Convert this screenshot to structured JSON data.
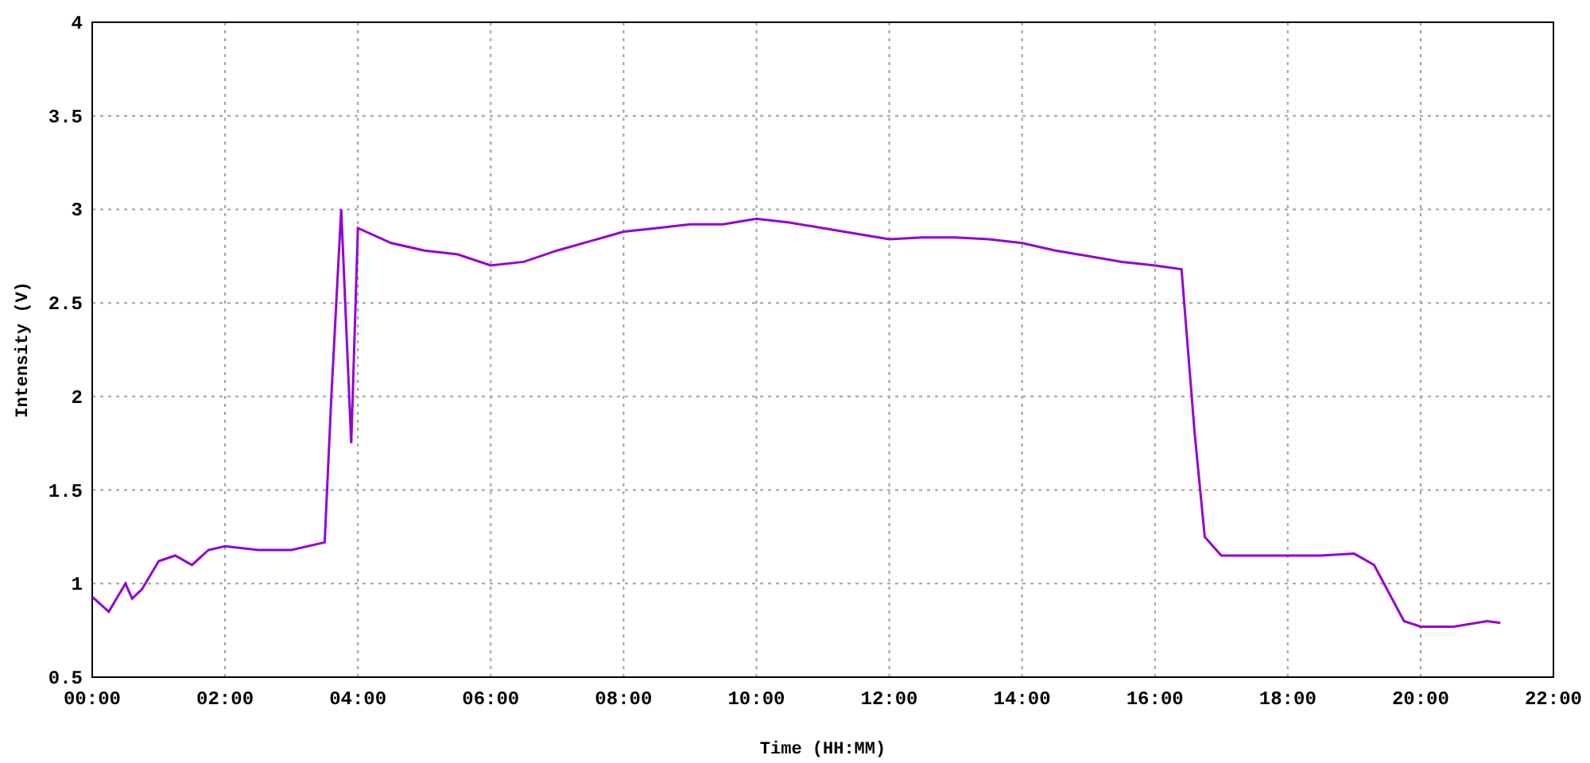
{
  "chart_data": {
    "type": "line",
    "grid": true,
    "xlabel": "Time (HH:MM)",
    "ylabel": "Intensity (V)",
    "x": [
      0,
      0.25,
      0.5,
      0.6,
      0.75,
      1,
      1.25,
      1.5,
      1.75,
      2,
      2.5,
      3,
      3.5,
      3.6,
      3.75,
      3.9,
      4,
      4.5,
      5,
      5.5,
      6,
      6.5,
      7,
      7.5,
      8,
      8.5,
      9,
      9.5,
      10,
      10.5,
      11,
      11.5,
      12,
      12.5,
      13,
      13.5,
      14,
      14.5,
      15,
      15.5,
      16,
      16.4,
      16.6,
      16.75,
      17,
      17.5,
      18,
      18.5,
      19,
      19.3,
      19.75,
      20,
      20.5,
      21,
      21.2
    ],
    "series": [
      {
        "color": "#9400d3",
        "values": [
          0.93,
          0.85,
          1.0,
          0.92,
          0.97,
          1.12,
          1.15,
          1.1,
          1.18,
          1.2,
          1.18,
          1.18,
          1.22,
          2.0,
          3.0,
          1.75,
          2.9,
          2.82,
          2.78,
          2.76,
          2.7,
          2.72,
          2.78,
          2.83,
          2.88,
          2.9,
          2.92,
          2.92,
          2.95,
          2.93,
          2.9,
          2.87,
          2.84,
          2.85,
          2.85,
          2.84,
          2.82,
          2.78,
          2.75,
          2.72,
          2.7,
          2.68,
          1.8,
          1.25,
          1.15,
          1.15,
          1.15,
          1.15,
          1.16,
          1.1,
          0.8,
          0.77,
          0.77,
          0.8,
          0.79
        ]
      }
    ],
    "xlim": [
      0,
      22
    ],
    "ylim": [
      0.5,
      4
    ],
    "xticks": [
      {
        "value": 0,
        "label": "00:00"
      },
      {
        "value": 2,
        "label": "02:00"
      },
      {
        "value": 4,
        "label": "04:00"
      },
      {
        "value": 6,
        "label": "06:00"
      },
      {
        "value": 8,
        "label": "08:00"
      },
      {
        "value": 10,
        "label": "10:00"
      },
      {
        "value": 12,
        "label": "12:00"
      },
      {
        "value": 14,
        "label": "14:00"
      },
      {
        "value": 16,
        "label": "16:00"
      },
      {
        "value": 18,
        "label": "18:00"
      },
      {
        "value": 20,
        "label": "20:00"
      },
      {
        "value": 22,
        "label": "22:00"
      }
    ],
    "yticks": [
      {
        "value": 0.5,
        "label": "0.5"
      },
      {
        "value": 1,
        "label": "1"
      },
      {
        "value": 1.5,
        "label": "1.5"
      },
      {
        "value": 2,
        "label": "2"
      },
      {
        "value": 2.5,
        "label": "2.5"
      },
      {
        "value": 3,
        "label": "3"
      },
      {
        "value": 3.5,
        "label": "3.5"
      },
      {
        "value": 4,
        "label": "4"
      }
    ]
  }
}
